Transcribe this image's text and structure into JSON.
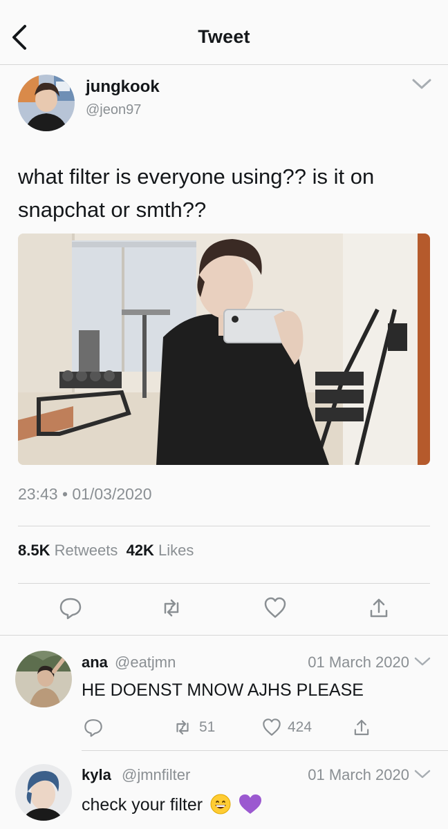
{
  "header": {
    "title": "Tweet"
  },
  "tweet": {
    "name": "jungkook",
    "handle": "@jeon97",
    "text_line1": "what filter is everyone using?? is it on",
    "text_line2": "snapchat or smth??",
    "timestamp": "23:43 • 01/03/2020",
    "retweets_count": "8.5K",
    "retweets_label": "Retweets",
    "likes_count": "42K",
    "likes_label": "Likes"
  },
  "replies": [
    {
      "name": "ana",
      "handle": "@eatjmn",
      "date": "01 March 2020",
      "text": "HE DOENST MNOW AJHS PLEASE",
      "retweets": "51",
      "likes": "424"
    },
    {
      "name": "kyla",
      "handle": "@jmnfilter",
      "date": "01 March 2020",
      "text": "check your filter"
    }
  ],
  "icons": {
    "back": "chevron-left-icon",
    "caret": "chevron-down-icon",
    "reply": "reply-bubble-icon",
    "retweet": "retweet-icon",
    "like": "heart-icon",
    "share": "share-icon",
    "emoji1": "grinning-face-emoji",
    "emoji2": "purple-heart-emoji"
  },
  "colors": {
    "text": "#14171a",
    "muted": "#8a8f93",
    "divider": "#d6d6d6",
    "purple_heart": "#9b59d0"
  }
}
